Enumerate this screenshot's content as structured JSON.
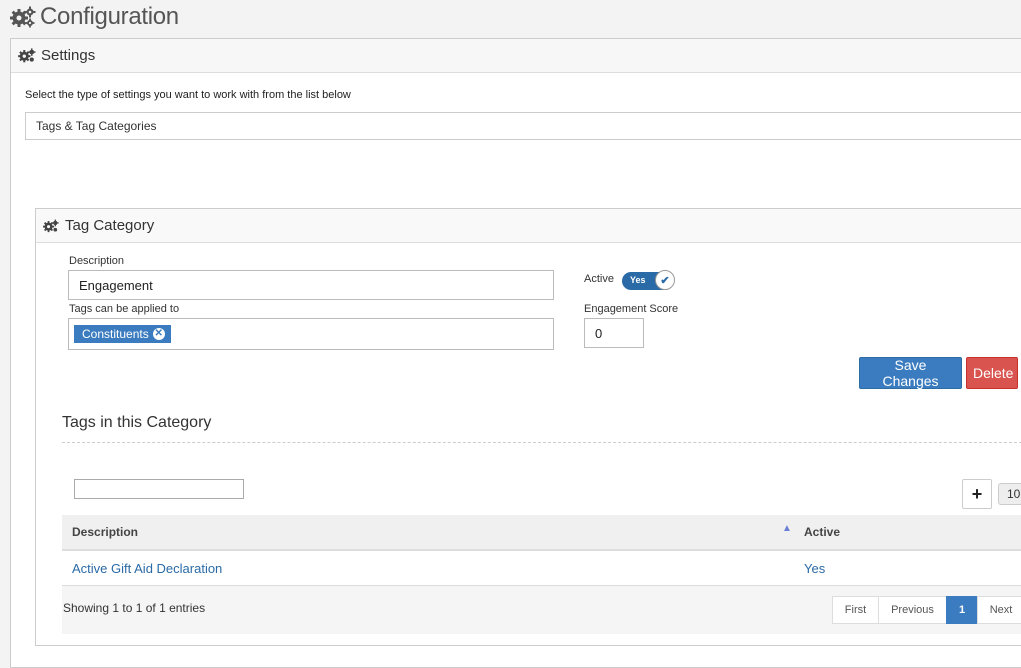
{
  "page": {
    "title": "Configuration"
  },
  "settings": {
    "title": "Settings",
    "instruction": "Select the type of settings you want to work with from the list below",
    "selected_type": "Tags & Tag Categories"
  },
  "tag_category": {
    "title": "Tag Category",
    "description_label": "Description",
    "description_value": "Engagement",
    "applies_label": "Tags can be applied to",
    "applies_chips": [
      "Constituents"
    ],
    "active_label": "Active",
    "active_value": "Yes",
    "score_label": "Engagement Score",
    "score_value": "0",
    "save_label": "Save Changes",
    "delete_label": "Delete"
  },
  "tags_section": {
    "title": "Tags in this Category",
    "add_label": "+",
    "page_length": "10",
    "columns": [
      "Description",
      "Active"
    ],
    "rows": [
      {
        "description": "Active Gift Aid Declaration",
        "active": "Yes"
      }
    ],
    "info": "Showing 1 to 1 of 1 entries",
    "pager": {
      "first": "First",
      "previous": "Previous",
      "current": "1",
      "next": "Next"
    }
  },
  "colors": {
    "primary": "#3b7bbf",
    "danger": "#d9534f"
  },
  "icons": {
    "title": "gears-icon",
    "panel": "gears-icon",
    "chip_remove": "remove-circle-icon",
    "toggle": "check-icon"
  }
}
